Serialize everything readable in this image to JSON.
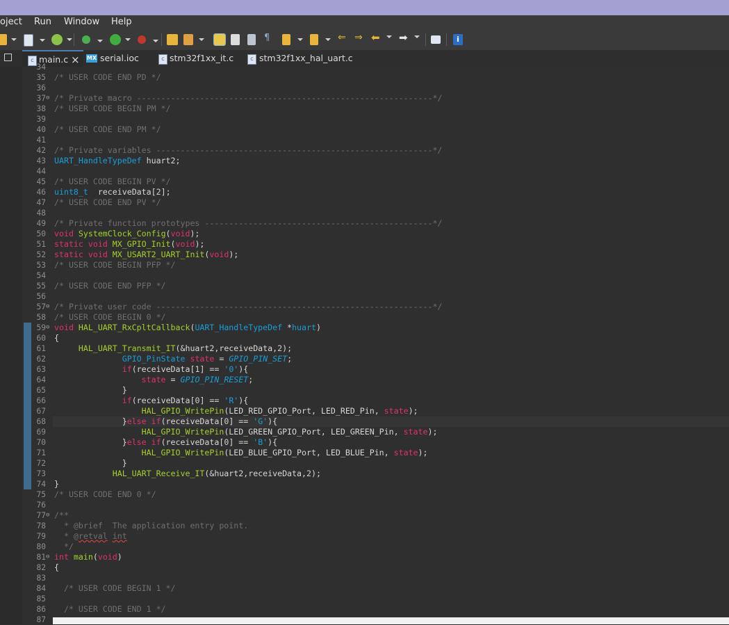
{
  "menu": {
    "items": [
      "oject",
      "Run",
      "Window",
      "Help"
    ]
  },
  "toolbar": {
    "icons": [
      "new-icon",
      "build-icon",
      "refresh-icon",
      "debug-icon",
      "run-icon",
      "external-tools-icon",
      "open-folder-icon",
      "pen-icon",
      "highlight-icon",
      "open-type-icon",
      "console-icon",
      "pilcrow-icon",
      "annotation-down-icon",
      "annotation-up-icon",
      "back-edit-icon",
      "forward-edit-icon",
      "back-icon",
      "forward-icon",
      "perspective-icon",
      "info-icon"
    ]
  },
  "tabs": [
    {
      "label": "main.c",
      "icon": "c-file-icon",
      "active": true,
      "close": "×"
    },
    {
      "label": "serial.ioc",
      "icon": "mx-file-icon",
      "active": false
    },
    {
      "label": "stm32f1xx_it.c",
      "icon": "c-file-icon",
      "active": false
    },
    {
      "label": "stm32f1xx_hal_uart.c",
      "icon": "c-file-icon",
      "active": false
    }
  ],
  "editor": {
    "lines": [
      {
        "n": "34",
        "text": ""
      },
      {
        "n": "35",
        "text": "/* USER CODE END PD */"
      },
      {
        "n": "36",
        "text": ""
      },
      {
        "n": "37",
        "text": "/* Private macro -------------------------------------------------------------*/"
      },
      {
        "n": "38",
        "text": "/* USER CODE BEGIN PM */"
      },
      {
        "n": "39",
        "text": ""
      },
      {
        "n": "40",
        "text": "/* USER CODE END PM */"
      },
      {
        "n": "41",
        "text": ""
      },
      {
        "n": "42",
        "text": "/* Private variables ---------------------------------------------------------*/"
      },
      {
        "n": "43",
        "text": "UART_HandleTypeDef huart2;"
      },
      {
        "n": "44",
        "text": ""
      },
      {
        "n": "45",
        "text": "/* USER CODE BEGIN PV */"
      },
      {
        "n": "46",
        "text": "uint8_t  receiveData[2];"
      },
      {
        "n": "47",
        "text": "/* USER CODE END PV */"
      },
      {
        "n": "48",
        "text": ""
      },
      {
        "n": "49",
        "text": "/* Private function prototypes -----------------------------------------------*/"
      },
      {
        "n": "50",
        "text": "void SystemClock_Config(void);"
      },
      {
        "n": "51",
        "text": "static void MX_GPIO_Init(void);"
      },
      {
        "n": "52",
        "text": "static void MX_USART2_UART_Init(void);"
      },
      {
        "n": "53",
        "text": "/* USER CODE BEGIN PFP */"
      },
      {
        "n": "54",
        "text": ""
      },
      {
        "n": "55",
        "text": "/* USER CODE END PFP */"
      },
      {
        "n": "56",
        "text": ""
      },
      {
        "n": "57",
        "text": "/* Private user code ---------------------------------------------------------*/"
      },
      {
        "n": "58",
        "text": "/* USER CODE BEGIN 0 */"
      },
      {
        "n": "59",
        "text": "void HAL_UART_RxCpltCallback(UART_HandleTypeDef *huart)"
      },
      {
        "n": "60",
        "text": "{"
      },
      {
        "n": "61",
        "text": "     HAL_UART_Transmit_IT(&huart2,receiveData,2);"
      },
      {
        "n": "62",
        "text": "              GPIO_PinState state = GPIO_PIN_SET;"
      },
      {
        "n": "63",
        "text": "              if(receiveData[1] == '0'){"
      },
      {
        "n": "64",
        "text": "                  state = GPIO_PIN_RESET;"
      },
      {
        "n": "65",
        "text": "              }"
      },
      {
        "n": "66",
        "text": "              if(receiveData[0] == 'R'){"
      },
      {
        "n": "67",
        "text": "                  HAL_GPIO_WritePin(LED_RED_GPIO_Port, LED_RED_Pin, state);"
      },
      {
        "n": "68",
        "text": "              }else if(receiveData[0] == 'G'){"
      },
      {
        "n": "69",
        "text": "                  HAL_GPIO_WritePin(LED_GREEN_GPIO_Port, LED_GREEN_Pin, state);"
      },
      {
        "n": "70",
        "text": "              }else if(receiveData[0] == 'B'){"
      },
      {
        "n": "71",
        "text": "                  HAL_GPIO_WritePin(LED_BLUE_GPIO_Port, LED_BLUE_Pin, state);"
      },
      {
        "n": "72",
        "text": "              }"
      },
      {
        "n": "73",
        "text": "            HAL_UART_Receive_IT(&huart2,receiveData,2);"
      },
      {
        "n": "74",
        "text": "}"
      },
      {
        "n": "75",
        "text": "/* USER CODE END 0 */"
      },
      {
        "n": "76",
        "text": ""
      },
      {
        "n": "77",
        "text": "/**"
      },
      {
        "n": "78",
        "text": "  * @brief  The application entry point."
      },
      {
        "n": "79",
        "text": "  * @retval int"
      },
      {
        "n": "80",
        "text": "  */"
      },
      {
        "n": "81",
        "text": "int main(void)"
      },
      {
        "n": "82",
        "text": "{"
      },
      {
        "n": "83",
        "text": ""
      },
      {
        "n": "84",
        "text": "  /* USER CODE BEGIN 1 */"
      },
      {
        "n": "85",
        "text": ""
      },
      {
        "n": "86",
        "text": "  /* USER CODE END 1 */"
      },
      {
        "n": "87",
        "text": ""
      }
    ]
  },
  "colors": {
    "comment": "#6f6f6f",
    "keyword": "#e0316b",
    "type": "#1a9ed8",
    "function": "#a5d12a",
    "background": "#2f2f2f",
    "titlebar": "#a3a0d2"
  }
}
